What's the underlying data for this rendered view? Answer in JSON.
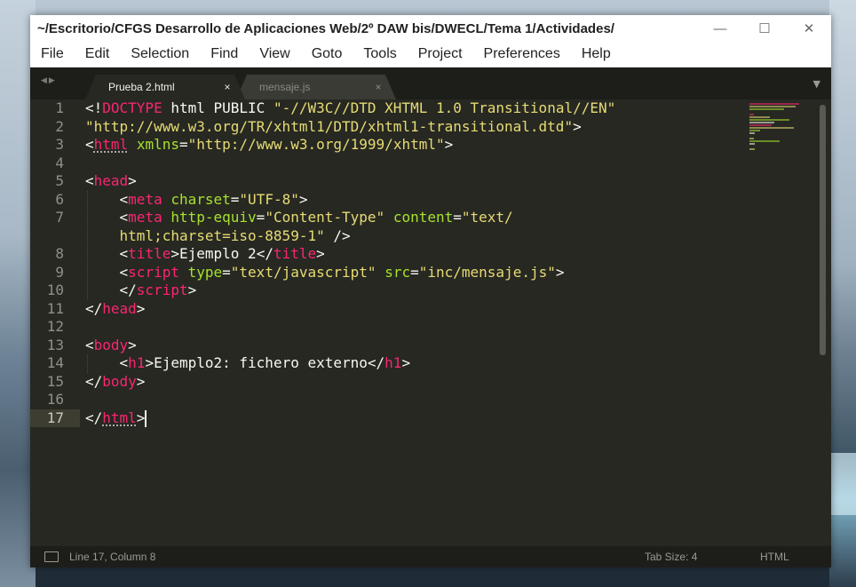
{
  "window": {
    "title": "~/Escritorio/CFGS Desarrollo de Aplicaciones Web/2º DAW bis/DWECL/Tema 1/Actividades/",
    "controls": {
      "minimize": "—",
      "maximize": "☐",
      "close": "✕"
    }
  },
  "menubar": {
    "items": [
      "File",
      "Edit",
      "Selection",
      "Find",
      "View",
      "Goto",
      "Tools",
      "Project",
      "Preferences",
      "Help"
    ]
  },
  "tabs": [
    {
      "label": "Prueba 2.html",
      "close": "×",
      "active": true
    },
    {
      "label": "mensaje.js",
      "close": "×",
      "active": false
    }
  ],
  "editor": {
    "line_numbers": [
      "1",
      "2",
      "3",
      "4",
      "5",
      "6",
      "7",
      "",
      "8",
      "9",
      "10",
      "11",
      "12",
      "13",
      "14",
      "15",
      "16",
      "17"
    ],
    "current_line": "17",
    "lines": [
      [
        {
          "c": "p",
          "t": "<!"
        },
        {
          "c": "tag",
          "t": "DOCTYPE"
        },
        {
          "c": "txt",
          "t": " html PUBLIC "
        },
        {
          "c": "str",
          "t": "\"-//W3C//DTD XHTML 1.0 Transitional//EN\""
        }
      ],
      [
        {
          "c": "str",
          "t": "\"http://www.w3.org/TR/xhtml1/DTD/xhtml1-transitional.dtd\""
        },
        {
          "c": "p",
          "t": ">"
        }
      ],
      [
        {
          "c": "p",
          "t": "<"
        },
        {
          "c": "tag",
          "t": "html",
          "u": true
        },
        {
          "c": "txt",
          "t": " "
        },
        {
          "c": "attr",
          "t": "xmlns"
        },
        {
          "c": "p",
          "t": "="
        },
        {
          "c": "str",
          "t": "\"http://www.w3.org/1999/xhtml\""
        },
        {
          "c": "p",
          "t": ">"
        }
      ],
      [],
      [
        {
          "c": "p",
          "t": "<"
        },
        {
          "c": "tag",
          "t": "head"
        },
        {
          "c": "p",
          "t": ">"
        }
      ],
      [
        {
          "c": "txt",
          "t": "    "
        },
        {
          "c": "p",
          "t": "<"
        },
        {
          "c": "tag",
          "t": "meta"
        },
        {
          "c": "txt",
          "t": " "
        },
        {
          "c": "attr",
          "t": "charset"
        },
        {
          "c": "p",
          "t": "="
        },
        {
          "c": "str",
          "t": "\"UTF-8\""
        },
        {
          "c": "p",
          "t": ">"
        }
      ],
      [
        {
          "c": "txt",
          "t": "    "
        },
        {
          "c": "p",
          "t": "<"
        },
        {
          "c": "tag",
          "t": "meta"
        },
        {
          "c": "txt",
          "t": " "
        },
        {
          "c": "attr",
          "t": "http-equiv"
        },
        {
          "c": "p",
          "t": "="
        },
        {
          "c": "str",
          "t": "\"Content-Type\""
        },
        {
          "c": "txt",
          "t": " "
        },
        {
          "c": "attr",
          "t": "content"
        },
        {
          "c": "p",
          "t": "="
        },
        {
          "c": "str",
          "t": "\"text/"
        }
      ],
      [
        {
          "c": "txt",
          "t": "    "
        },
        {
          "c": "str",
          "t": "html;charset=iso-8859-1\""
        },
        {
          "c": "txt",
          "t": " "
        },
        {
          "c": "p",
          "t": "/>"
        }
      ],
      [
        {
          "c": "txt",
          "t": "    "
        },
        {
          "c": "p",
          "t": "<"
        },
        {
          "c": "tag",
          "t": "title"
        },
        {
          "c": "p",
          "t": ">"
        },
        {
          "c": "txt",
          "t": "Ejemplo 2"
        },
        {
          "c": "p",
          "t": "</"
        },
        {
          "c": "tag",
          "t": "title"
        },
        {
          "c": "p",
          "t": ">"
        }
      ],
      [
        {
          "c": "txt",
          "t": "    "
        },
        {
          "c": "p",
          "t": "<"
        },
        {
          "c": "tag",
          "t": "script"
        },
        {
          "c": "txt",
          "t": " "
        },
        {
          "c": "attr",
          "t": "type"
        },
        {
          "c": "p",
          "t": "="
        },
        {
          "c": "str",
          "t": "\"text/javascript\""
        },
        {
          "c": "txt",
          "t": " "
        },
        {
          "c": "attr",
          "t": "src"
        },
        {
          "c": "p",
          "t": "="
        },
        {
          "c": "str",
          "t": "\"inc/mensaje.js\""
        },
        {
          "c": "p",
          "t": ">"
        }
      ],
      [
        {
          "c": "txt",
          "t": "    "
        },
        {
          "c": "p",
          "t": "</"
        },
        {
          "c": "tag",
          "t": "script"
        },
        {
          "c": "p",
          "t": ">"
        }
      ],
      [
        {
          "c": "p",
          "t": "</"
        },
        {
          "c": "tag",
          "t": "head"
        },
        {
          "c": "p",
          "t": ">"
        }
      ],
      [],
      [
        {
          "c": "p",
          "t": "<"
        },
        {
          "c": "tag",
          "t": "body"
        },
        {
          "c": "p",
          "t": ">"
        }
      ],
      [
        {
          "c": "txt",
          "t": "    "
        },
        {
          "c": "p",
          "t": "<"
        },
        {
          "c": "tag",
          "t": "h1"
        },
        {
          "c": "p",
          "t": ">"
        },
        {
          "c": "txt",
          "t": "Ejemplo2: fichero externo"
        },
        {
          "c": "p",
          "t": "</"
        },
        {
          "c": "tag",
          "t": "h1"
        },
        {
          "c": "p",
          "t": ">"
        }
      ],
      [
        {
          "c": "p",
          "t": "</"
        },
        {
          "c": "tag",
          "t": "body"
        },
        {
          "c": "p",
          "t": ">"
        }
      ],
      [],
      [
        {
          "c": "p",
          "t": "</"
        },
        {
          "c": "tag",
          "t": "html",
          "u": true
        },
        {
          "c": "p",
          "t": ">"
        }
      ]
    ]
  },
  "statusbar": {
    "position": "Line 17, Column 8",
    "tab_size": "Tab Size: 4",
    "syntax": "HTML"
  },
  "colors": {
    "background": "#272822",
    "tag": "#f92672",
    "attribute": "#a6e22e",
    "string": "#e6db74",
    "text": "#f8f8f2"
  }
}
